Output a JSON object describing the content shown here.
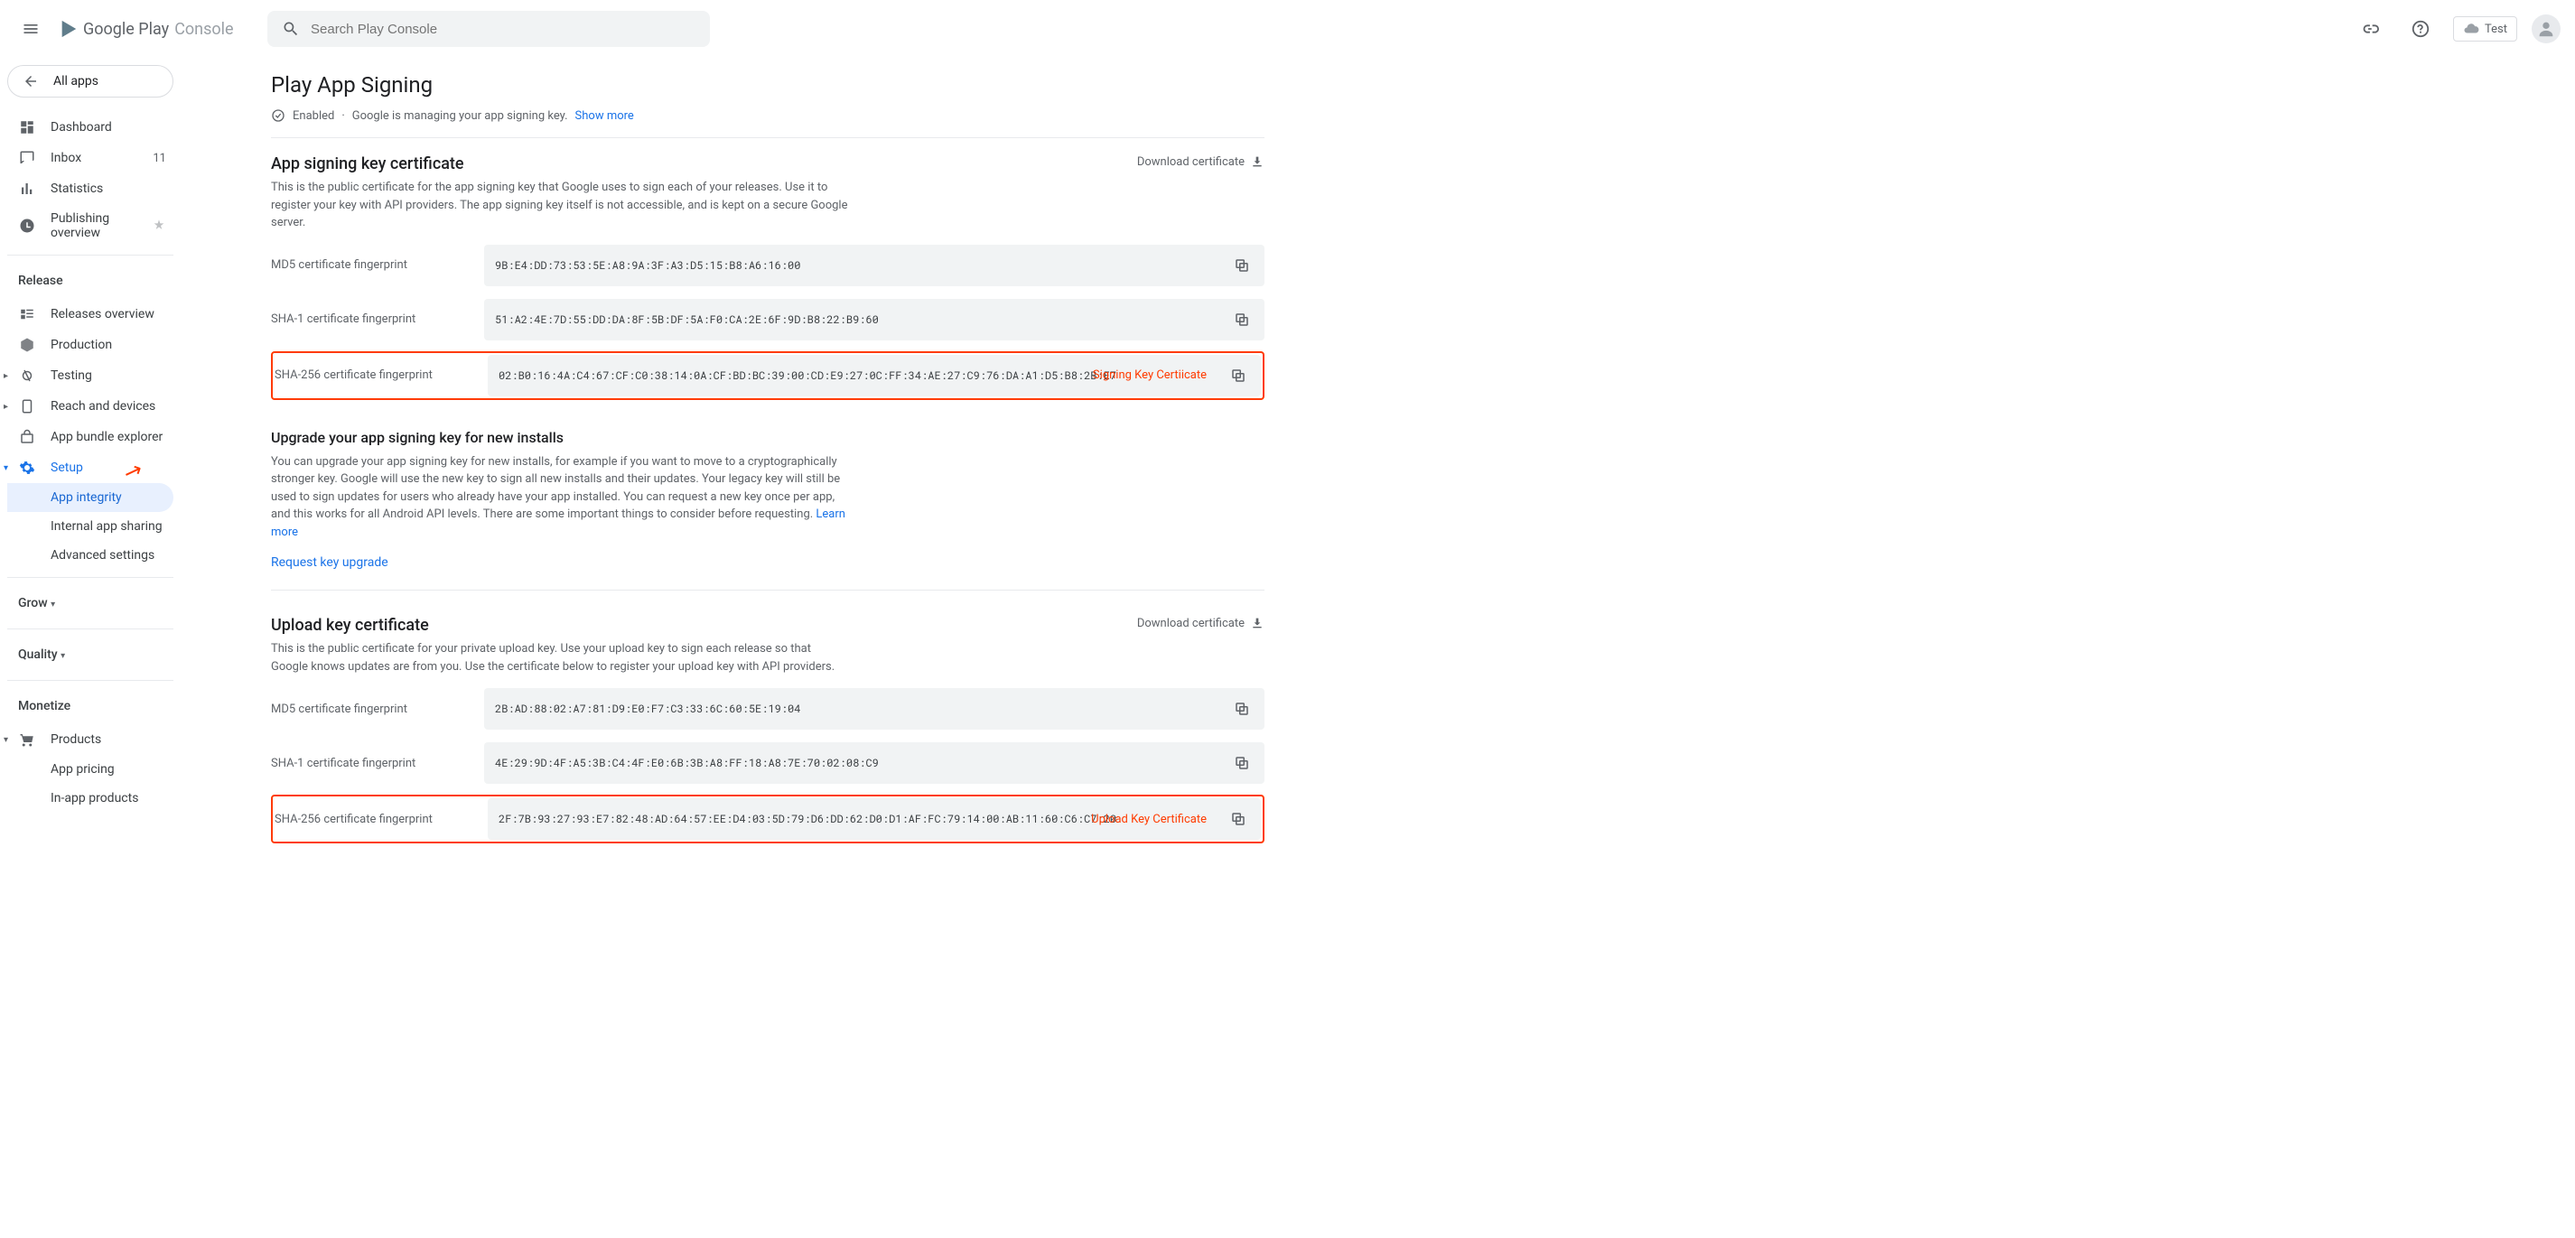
{
  "header": {
    "logo1": "Google Play",
    "logo2": "Console",
    "searchPlaceholder": "Search Play Console",
    "testLabel": "Test"
  },
  "sidebar": {
    "allApps": "All apps",
    "dashboard": "Dashboard",
    "inbox": "Inbox",
    "inboxCount": "11",
    "statistics": "Statistics",
    "publishingOverview": "Publishing overview",
    "releaseHeader": "Release",
    "releasesOverview": "Releases overview",
    "production": "Production",
    "testing": "Testing",
    "reachDevices": "Reach and devices",
    "appBundleExplorer": "App bundle explorer",
    "setup": "Setup",
    "appIntegrity": "App integrity",
    "internalAppSharing": "Internal app sharing",
    "advancedSettings": "Advanced settings",
    "grow": "Grow",
    "quality": "Quality",
    "monetize": "Monetize",
    "products": "Products",
    "appPricing": "App pricing",
    "inAppProducts": "In-app products"
  },
  "page": {
    "title": "Play App Signing",
    "enabled": "Enabled",
    "statusText": "Google is managing your app signing key.",
    "showMore": "Show more"
  },
  "signing": {
    "title": "App signing key certificate",
    "desc": "This is the public certificate for the app signing key that Google uses to sign each of your releases. Use it to register your key with API providers. The app signing key itself is not accessible, and is kept on a secure Google server.",
    "download": "Download certificate",
    "md5Label": "MD5 certificate fingerprint",
    "md5Value": "9B:E4:DD:73:53:5E:A8:9A:3F:A3:D5:15:B8:A6:16:00",
    "sha1Label": "SHA-1 certificate fingerprint",
    "sha1Value": "51:A2:4E:7D:55:DD:DA:8F:5B:DF:5A:F0:CA:2E:6F:9D:B8:22:B9:60",
    "sha256Label": "SHA-256 certificate fingerprint",
    "sha256Value": "02:B0:16:4A:C4:67:CF:C0:38:14:0A:CF:BD:BC:39:00:CD:E9:27:0C:FF:34:AE:27:C9:76:DA:A1:D5:B8:2B:E7",
    "annotation": "Signing Key Certiicate"
  },
  "upgrade": {
    "title": "Upgrade your app signing key for new installs",
    "desc": "You can upgrade your app signing key for new installs, for example if you want to move to a cryptographically stronger key. Google will use the new key to sign all new installs and their updates. Your legacy key will still be used to sign updates for users who already have your app installed. You can request a new key once per app, and this works for all Android API levels. There are some important things to consider before requesting. ",
    "learnMore": "Learn more",
    "request": "Request key upgrade"
  },
  "upload": {
    "title": "Upload key certificate",
    "desc": "This is the public certificate for your private upload key. Use your upload key to sign each release so that Google knows updates are from you. Use the certificate below to register your upload key with API providers.",
    "download": "Download certificate",
    "md5Label": "MD5 certificate fingerprint",
    "md5Value": "2B:AD:88:02:A7:81:D9:E0:F7:C3:33:6C:60:5E:19:04",
    "sha1Label": "SHA-1 certificate fingerprint",
    "sha1Value": "4E:29:9D:4F:A5:3B:C4:4F:E0:6B:3B:A8:FF:18:A8:7E:70:02:08:C9",
    "sha256Label": "SHA-256 certificate fingerprint",
    "sha256Value": "2F:7B:93:27:93:E7:82:48:AD:64:57:EE:D4:03:5D:79:D6:DD:62:D0:D1:AF:FC:79:14:00:AB:11:60:C6:C7:20",
    "annotation": "Upload Key Certificate"
  }
}
